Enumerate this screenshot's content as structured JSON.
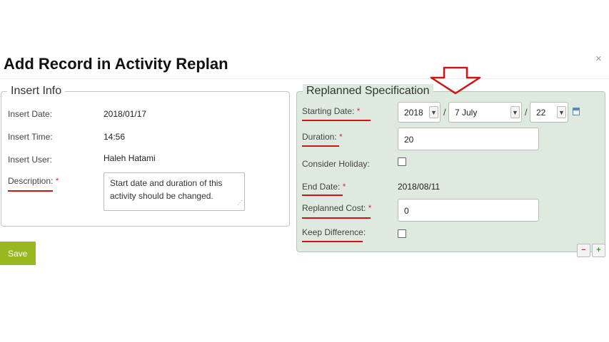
{
  "dialog": {
    "title": "Add Record in Activity Replan",
    "close_glyph": "×"
  },
  "insert_info": {
    "legend": "Insert Info",
    "insert_date_label": "Insert Date:",
    "insert_date_value": "2018/01/17",
    "insert_time_label": "Insert Time:",
    "insert_time_value": "14:56",
    "insert_user_label": "Insert User:",
    "insert_user_value": "Haleh Hatami",
    "description_label": "Description:",
    "required_mark": "*",
    "description_value": "Start date and duration of this activity should be changed."
  },
  "replan": {
    "legend": "Replanned Specification",
    "starting_date_label": "Starting Date:",
    "starting_year": "2018",
    "starting_month": "7 July",
    "starting_day": "22",
    "date_separator": "/",
    "duration_label": "Duration:",
    "duration_value": "20",
    "consider_holiday_label": "Consider Holiday:",
    "consider_holiday_checked": false,
    "end_date_label": "End Date:",
    "end_date_value": "2018/08/11",
    "replanned_cost_label": "Replanned Cost:",
    "replanned_cost_value": "0",
    "keep_difference_label": "Keep Difference:",
    "keep_difference_checked": false,
    "required_mark": "*",
    "remove_glyph": "−",
    "add_glyph": "+"
  },
  "actions": {
    "save_label": "Save"
  },
  "icons": {
    "select_arrow": "chevron-down-icon",
    "calendar": "calendar-icon",
    "annotation_arrow": "down-arrow-icon"
  },
  "colors": {
    "save_button": "#9ab81f",
    "replan_panel": "#deeadf",
    "required": "#e03030",
    "annotation": "#d01414"
  }
}
